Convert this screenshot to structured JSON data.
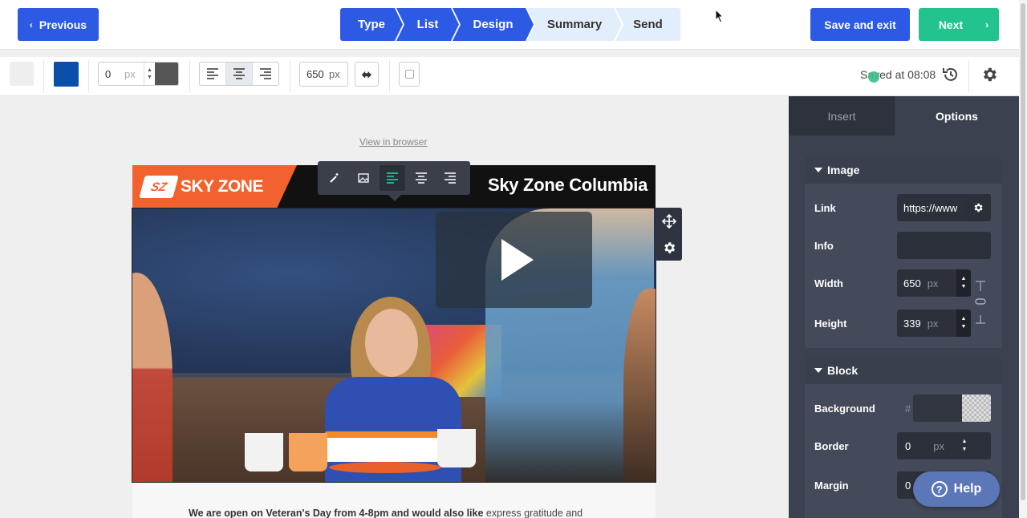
{
  "header": {
    "previous_label": "Previous",
    "steps": [
      {
        "label": "Type",
        "state": "done"
      },
      {
        "label": "List",
        "state": "done"
      },
      {
        "label": "Design",
        "state": "done"
      },
      {
        "label": "Summary",
        "state": "todo"
      },
      {
        "label": "Send",
        "state": "todo"
      }
    ],
    "save_exit_label": "Save and exit",
    "next_label": "Next"
  },
  "toolbar": {
    "border_width": "0",
    "border_unit": "px",
    "content_width": "650",
    "content_unit": "px",
    "saved_status": "Saved at 08:08",
    "colors": {
      "background": "#eeeeee",
      "accent": "#0a4fa8",
      "border": "#555555"
    }
  },
  "canvas": {
    "view_in_browser": "View in browser",
    "header_title": "Sky Zone Columbia",
    "logo_mark": "SZ",
    "logo_text": "SKY ZONE",
    "body_text_bold": "We are open on Veteran's Day from 4-8pm and would also like",
    "body_text_rest": " express gratitude and"
  },
  "panel": {
    "tabs": [
      {
        "label": "Insert"
      },
      {
        "label": "Options"
      }
    ],
    "image_section": {
      "title": "Image",
      "link_label": "Link",
      "link_value": "https://www",
      "info_label": "Info",
      "info_value": "",
      "width_label": "Width",
      "width_value": "650",
      "height_label": "Height",
      "height_value": "339",
      "unit": "px"
    },
    "block_section": {
      "title": "Block",
      "background_label": "Background",
      "background_hash": "#",
      "border_label": "Border",
      "border_value": "0",
      "margin_label": "Margin",
      "margin_value": "0",
      "unit": "px"
    },
    "help_label": "Help"
  },
  "colors": {
    "primary": "#2c5ae5",
    "success": "#22c38e",
    "panel_bg": "#3c4150",
    "step_todo": "#e2eefb"
  }
}
